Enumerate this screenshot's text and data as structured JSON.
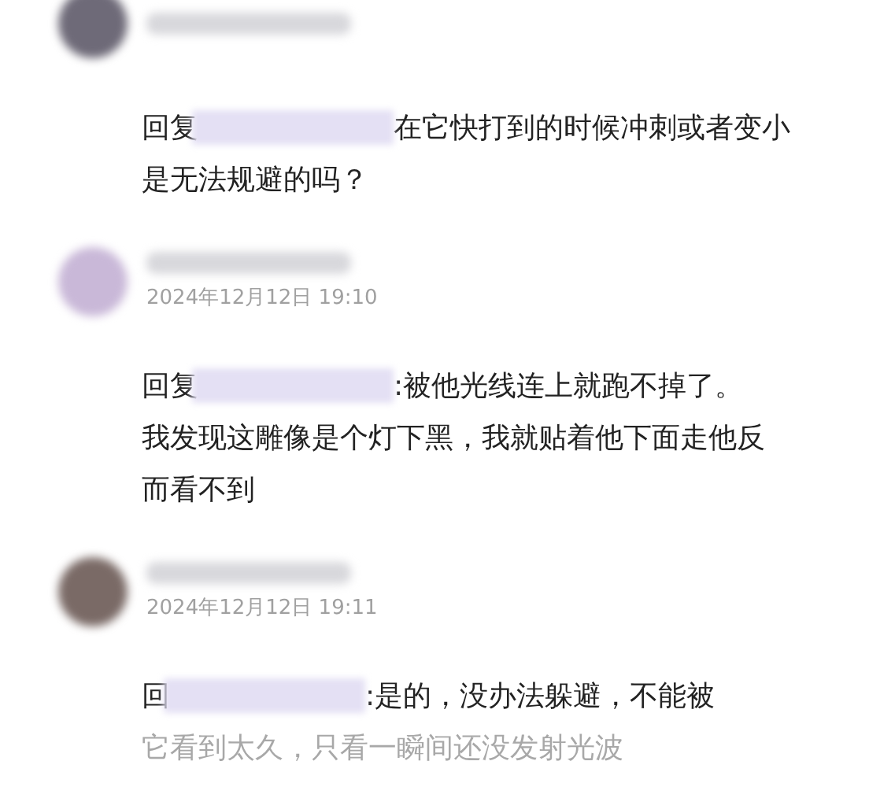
{
  "comments": [
    {
      "reply_prefix": "回复",
      "lines": [
        {
          "text": "在它快打到的时候冲刺或者变小",
          "faded": false
        },
        {
          "text": "是无法规避的吗？",
          "faded": false
        }
      ]
    },
    {
      "date": "2024年12月12日 19:10",
      "reply_prefix": "回复",
      "lines": [
        {
          "text": ":被他光线连上就跑不掉了。",
          "faded": false
        },
        {
          "text": "我发现这雕像是个灯下黑，我就贴着他下面走他反",
          "faded": false
        },
        {
          "text": "而看不到",
          "faded": false
        }
      ]
    },
    {
      "date": "2024年12月12日 19:11",
      "reply_prefix": "回",
      "lines": [
        {
          "text": ":是的，没办法躲避，不能被",
          "faded": false
        },
        {
          "text": "它看到太久，只看一瞬间还没发射光波",
          "faded": true
        }
      ]
    }
  ]
}
